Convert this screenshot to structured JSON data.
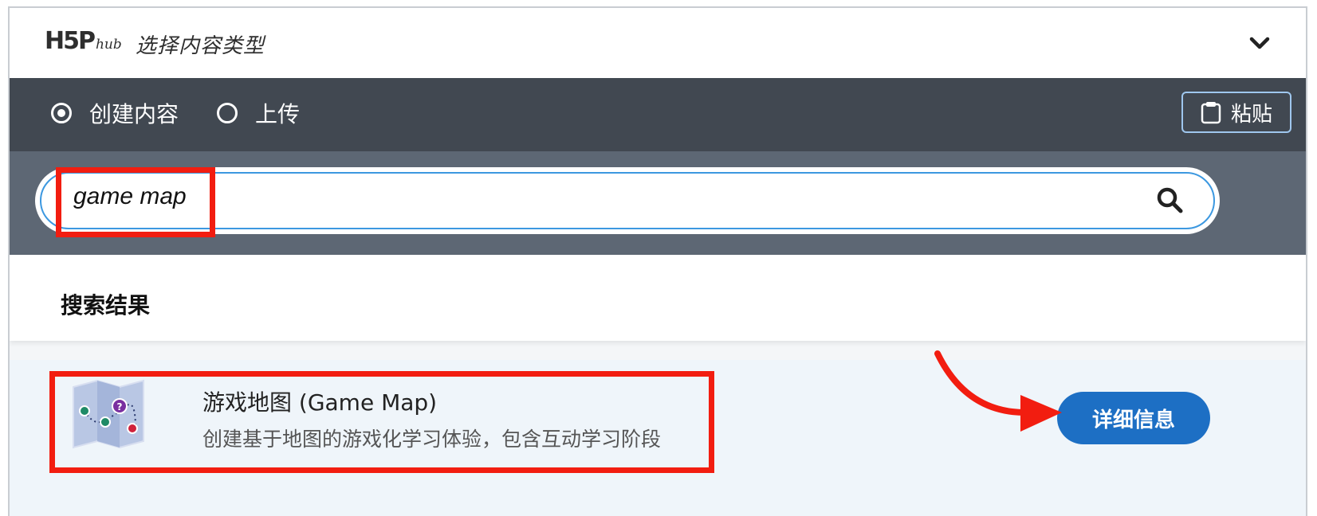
{
  "header": {
    "logo_text": "H5P",
    "logo_sub": "hub",
    "title": "选择内容类型"
  },
  "tabs": [
    {
      "label": "创建内容",
      "selected": true
    },
    {
      "label": "上传",
      "selected": false
    }
  ],
  "paste_label": "粘贴",
  "search": {
    "value": "game map"
  },
  "results": {
    "heading": "搜索结果",
    "items": [
      {
        "title": "游戏地图 (Game Map)",
        "description": "创建基于地图的游戏化学习体验，包含互动学习阶段",
        "details_label": "详细信息"
      }
    ]
  },
  "colors": {
    "tabs_bg": "#414851",
    "search_bg": "#5d6774",
    "accent": "#1d6fc4",
    "highlight": "#f21d10"
  }
}
